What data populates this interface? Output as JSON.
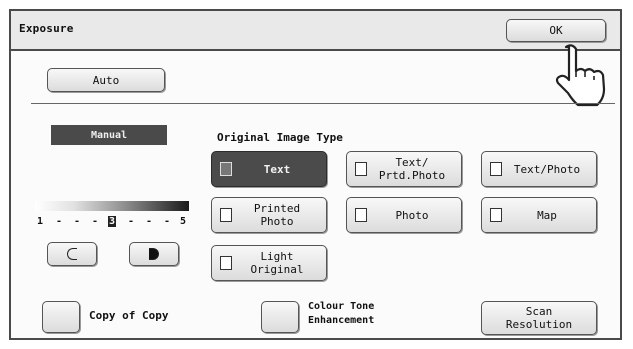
{
  "window": {
    "title": "Exposure",
    "ok_label": "OK"
  },
  "mode_buttons": {
    "auto_label": "Auto",
    "manual_label": "Manual"
  },
  "original_image_type": {
    "heading": "Original Image Type",
    "selected": "Text",
    "options": [
      {
        "label": "Text",
        "icon": "text-doc-icon"
      },
      {
        "label": "Text/\nPrtd.Photo",
        "icon": "text-printed-photo-icon"
      },
      {
        "label": "Text/Photo",
        "icon": "text-photo-icon"
      },
      {
        "label": "Printed\nPhoto",
        "icon": "printed-photo-icon"
      },
      {
        "label": "Photo",
        "icon": "photo-icon"
      },
      {
        "label": "Map",
        "icon": "map-icon"
      },
      {
        "label": "Light\nOriginal",
        "icon": "light-original-icon"
      }
    ]
  },
  "exposure_level": {
    "scale_text": [
      "1",
      "-",
      "-",
      "-",
      "3",
      "-",
      "-",
      "-",
      "5"
    ],
    "current": 3,
    "min": 1,
    "max": 5,
    "lighter_icon": "lighter-half-circle-icon",
    "darker_icon": "darker-half-circle-icon"
  },
  "bottom_options": {
    "copy_of_copy": "Copy of Copy",
    "colour_tone_line1": "Colour Tone",
    "colour_tone_line2": "Enhancement",
    "scan_resolution": "Scan\nResolution"
  }
}
